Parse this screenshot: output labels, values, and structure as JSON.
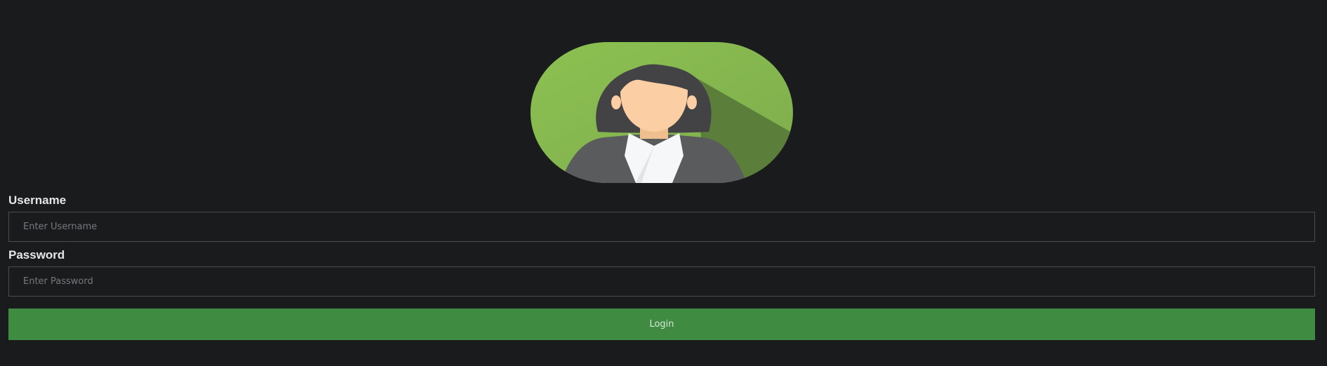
{
  "avatar": {
    "icon": "user-avatar-icon",
    "colors": {
      "background": "#8cc152",
      "hair": "#434345",
      "skin": "#fccea3",
      "jacket": "#5a5b5d",
      "collar": "#f6f7f9"
    }
  },
  "form": {
    "username": {
      "label": "Username",
      "placeholder": "Enter Username",
      "value": ""
    },
    "password": {
      "label": "Password",
      "placeholder": "Enter Password",
      "value": ""
    },
    "login_label": "Login"
  },
  "colors": {
    "page_background": "#1a1b1d",
    "button_background": "#3e8b41",
    "input_border": "#4a4b4e"
  }
}
